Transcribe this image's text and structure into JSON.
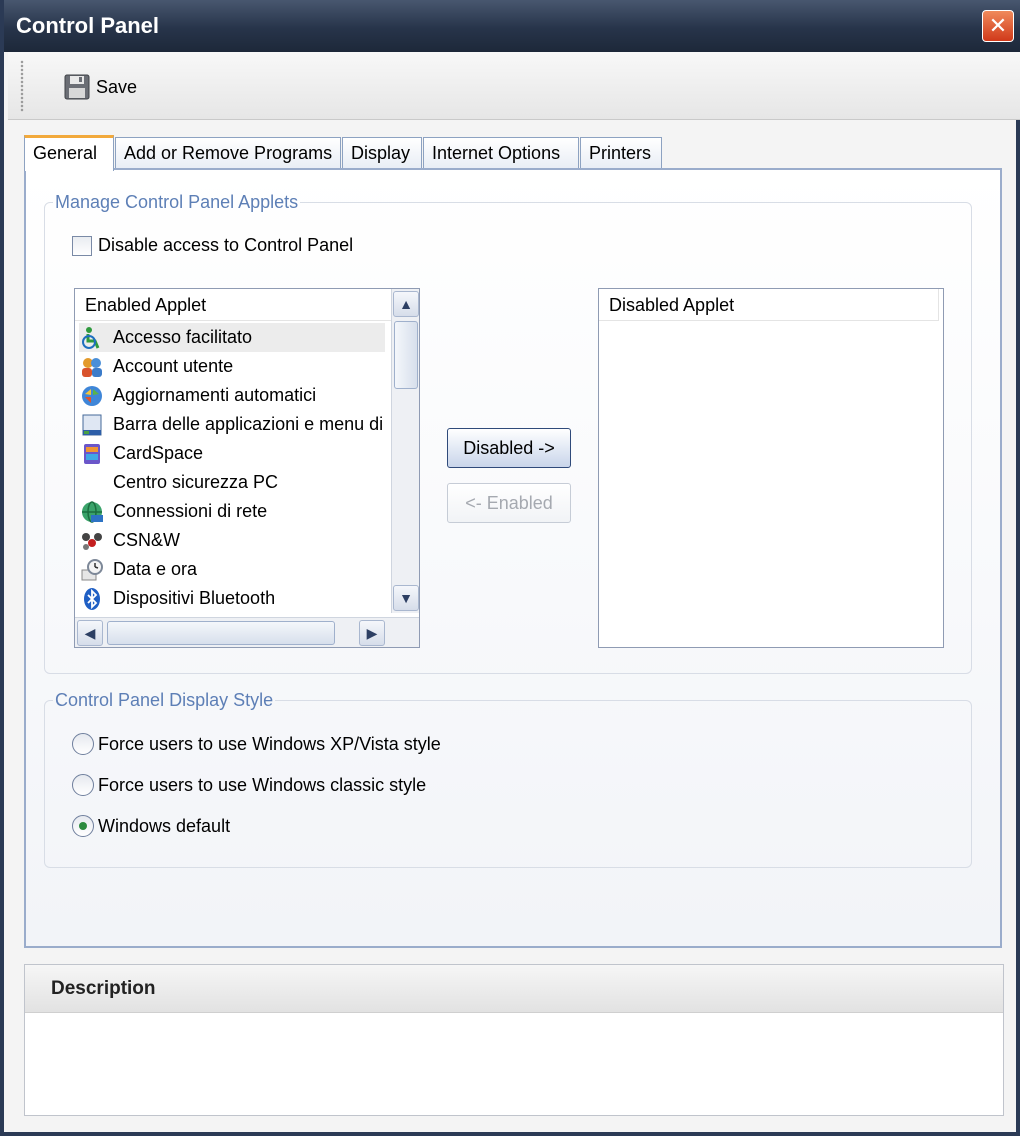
{
  "window": {
    "title": "Control Panel",
    "close_glyph": "✕"
  },
  "toolbar": {
    "save_label": "Save"
  },
  "tabs": [
    {
      "label": "General",
      "active": true
    },
    {
      "label": "Add or Remove Programs"
    },
    {
      "label": "Display"
    },
    {
      "label": "Internet Options"
    },
    {
      "label": "Printers"
    }
  ],
  "manage": {
    "legend": "Manage Control Panel Applets",
    "disable_label": "Disable access to Control Panel",
    "enabled_header": "Enabled Applet",
    "disabled_header": "Disabled Applet",
    "enabled_items": [
      {
        "label": "Accesso facilitato",
        "icon": "accessibility-icon"
      },
      {
        "label": "Account utente",
        "icon": "users-icon"
      },
      {
        "label": "Aggiornamenti automatici",
        "icon": "windows-update-icon"
      },
      {
        "label": "Barra delle applicazioni e menu di",
        "icon": "taskbar-icon"
      },
      {
        "label": "CardSpace",
        "icon": "cardspace-icon"
      },
      {
        "label": "Centro sicurezza PC",
        "icon": ""
      },
      {
        "label": "Connessioni di rete",
        "icon": "network-icon"
      },
      {
        "label": "CSN&W",
        "icon": "csnw-icon"
      },
      {
        "label": "Data e ora",
        "icon": "date-time-icon"
      },
      {
        "label": "Dispositivi Bluetooth",
        "icon": "bluetooth-icon"
      }
    ],
    "disabled_items": [],
    "move_disabled_label": "Disabled ->",
    "move_enabled_label": "<- Enabled"
  },
  "display_style": {
    "legend": "Control Panel Display Style",
    "options": [
      {
        "label": "Force users to use Windows XP/Vista style",
        "checked": false
      },
      {
        "label": "Force users to use Windows classic style",
        "checked": false
      },
      {
        "label": "Windows default",
        "checked": true
      }
    ]
  },
  "description": {
    "title": "Description"
  },
  "colors": {
    "title_bar": "#27344a",
    "legend_text": "#5d7fb6",
    "active_tab_accent": "#f2a93b",
    "close_button": "#d0391a"
  }
}
